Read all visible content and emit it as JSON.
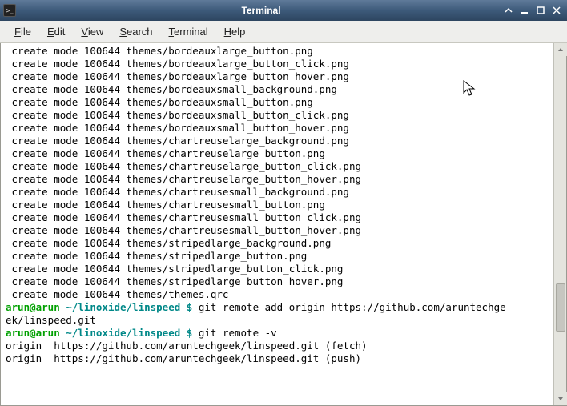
{
  "window": {
    "title": "Terminal",
    "app_icon_glyph": ">_"
  },
  "menubar": {
    "file": {
      "u": "F",
      "rest": "ile"
    },
    "edit": {
      "u": "E",
      "rest": "dit"
    },
    "view": {
      "u": "V",
      "rest": "iew"
    },
    "search": {
      "u": "S",
      "rest": "earch"
    },
    "terminal": {
      "u": "T",
      "rest": "erminal"
    },
    "help": {
      "u": "H",
      "rest": "elp"
    }
  },
  "terminal": {
    "create_lines": [
      " create mode 100644 themes/bordeauxlarge_button.png",
      " create mode 100644 themes/bordeauxlarge_button_click.png",
      " create mode 100644 themes/bordeauxlarge_button_hover.png",
      " create mode 100644 themes/bordeauxsmall_background.png",
      " create mode 100644 themes/bordeauxsmall_button.png",
      " create mode 100644 themes/bordeauxsmall_button_click.png",
      " create mode 100644 themes/bordeauxsmall_button_hover.png",
      " create mode 100644 themes/chartreuselarge_background.png",
      " create mode 100644 themes/chartreuselarge_button.png",
      " create mode 100644 themes/chartreuselarge_button_click.png",
      " create mode 100644 themes/chartreuselarge_button_hover.png",
      " create mode 100644 themes/chartreusesmall_background.png",
      " create mode 100644 themes/chartreusesmall_button.png",
      " create mode 100644 themes/chartreusesmall_button_click.png",
      " create mode 100644 themes/chartreusesmall_button_hover.png",
      " create mode 100644 themes/stripedlarge_background.png",
      " create mode 100644 themes/stripedlarge_button.png",
      " create mode 100644 themes/stripedlarge_button_click.png",
      " create mode 100644 themes/stripedlarge_button_hover.png",
      " create mode 100644 themes/themes.qrc"
    ],
    "prompt1": {
      "userhost": "arun@arun ",
      "cwd": "~/linoxide/linspeed $",
      "cmd_part1": " git remote add origin https://github.com/aruntechge",
      "cmd_wrap": "ek/linspeed.git"
    },
    "prompt2": {
      "userhost": "arun@arun ",
      "cwd": "~/linoxide/linspeed $",
      "cmd": " git remote -v"
    },
    "output1": "origin  https://github.com/aruntechgeek/linspeed.git (fetch)",
    "output2": "origin  https://github.com/aruntechgeek/linspeed.git (push)"
  }
}
